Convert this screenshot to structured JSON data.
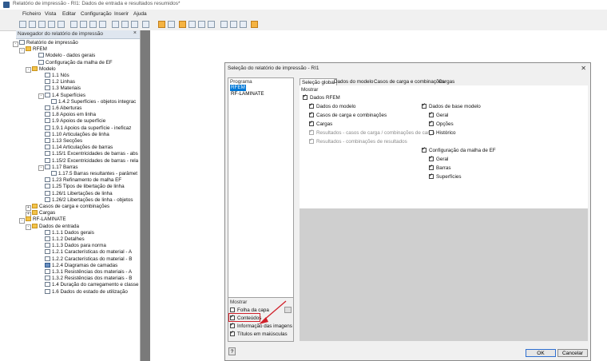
{
  "window": {
    "title": "Relatório de impressão - RI1: Dados de entrada e resultados resumidos*"
  },
  "menu": [
    "Ficheiro",
    "Vista",
    "Editar",
    "Configuração",
    "Inserir",
    "Ajuda"
  ],
  "navigator": {
    "header": "Navegador do relatório de impressão",
    "close": "×",
    "items": [
      "Relatório de impressão",
      "RFEM",
      "Modelo - dados gerais",
      "Configuração da malha de EF",
      "Modelo",
      "1.1 Nós",
      "1.2 Linhas",
      "1.3 Materiais",
      "1.4 Superfícies",
      "1.4.2 Superfícies - objetos integrac",
      "1.6 Aberturas",
      "1.8 Apoios em linha",
      "1.9 Apoios de superfície",
      "1.9.1 Apoios da superfície - ineficaz",
      "1.10 Articulações de linha",
      "1.13 Secções",
      "1.14 Articulações de barras",
      "1.15/1 Excentricidades de barras - abs",
      "1.15/2 Excentricidades de barras - rela",
      "1.17 Barras",
      "1.17.5 Barras resultantes - parâmet",
      "1.23 Refinamento de malha EF",
      "1.25 Tipos de libertação de linha",
      "1.26/1 Libertações de linha",
      "1.26/2 Libertações de linha - objetos",
      "Casos de carga e combinações",
      "Cargas",
      "RF-LAMINATE",
      "Dados de entrada",
      "1.1.1 Dados gerais",
      "1.1.2 Detalhes",
      "1.1.3 Dados para norma",
      "1.2.1 Características do material - A",
      "1.2.2 Características do material - B",
      "1.2.4 Diagramas de camadas",
      "1.3.1 Resistências dos materiais - A",
      "1.3.2 Resistências dos materiais - B",
      "1.4 Duração do carregamento e classe",
      "1.6 Dados do estado de utilização"
    ]
  },
  "dialog": {
    "title": "Seleção do relatório de impressão - RI1",
    "close": "✕",
    "programs": {
      "header": "Programa",
      "items": [
        "RFEM",
        "RF-LAMINATE"
      ]
    },
    "show_panel": {
      "header": "Mostrar",
      "folha_capa": "Folha da capa",
      "conteudos": "Conteúdos",
      "info_imagens": "Informação das imagens",
      "titulos": "Títulos em maiúsculas"
    },
    "tabs": [
      "Seleção global",
      "Dados do modelo",
      "Casos de carga e combinações",
      "Cargas"
    ],
    "content": {
      "header": "Mostrar",
      "dados_rfem": "Dados RFEM",
      "dados_modelo": "Dados do modelo",
      "casos_carga": "Casos de carga e combinações",
      "cargas": "Cargas",
      "resultados_casos": "Resultados - casos de carga / combinações de carga",
      "resultados_comb": "Resultados - combinações de resultados",
      "dados_base": "Dados de base modelo",
      "geral": "Geral",
      "opcoes": "Opções",
      "historico": "Histórico",
      "config_malha": "Configuração da malha de EF",
      "geral2": "Geral",
      "barras": "Barras",
      "superficies": "Superfícies"
    },
    "buttons": {
      "ok": "OK",
      "cancel": "Cancelar",
      "help": "?"
    }
  },
  "colors": {
    "highlight": "#d0202a",
    "selection": "#0078d7"
  }
}
